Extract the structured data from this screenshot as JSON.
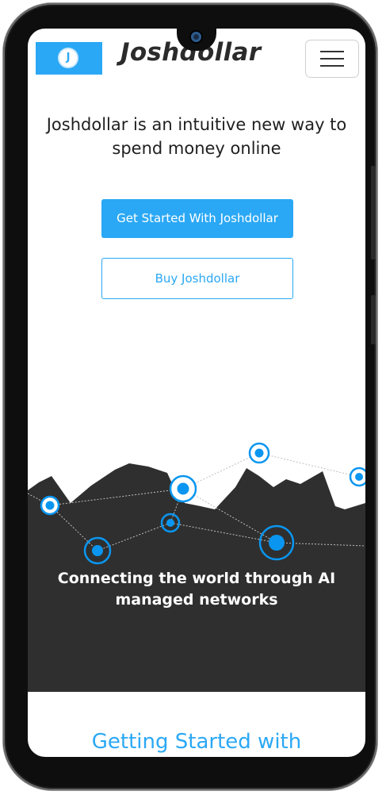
{
  "nav": {
    "logo_letter": "J",
    "brand": "Joshdollar"
  },
  "hero": {
    "headline": "Joshdollar is an intuitive new way to spend money online",
    "primary_button": "Get Started With Joshdollar",
    "secondary_button": "Buy Joshdollar"
  },
  "network": {
    "tagline": "Connecting the world through AI managed networks"
  },
  "next_section": {
    "title": "Getting Started with"
  },
  "colors": {
    "accent": "#2ba8f5",
    "dark": "#2f2f2f",
    "node": "#0a96f0"
  },
  "icons": [
    "menu-icon",
    "camera-icon",
    "coin-logo-icon"
  ]
}
